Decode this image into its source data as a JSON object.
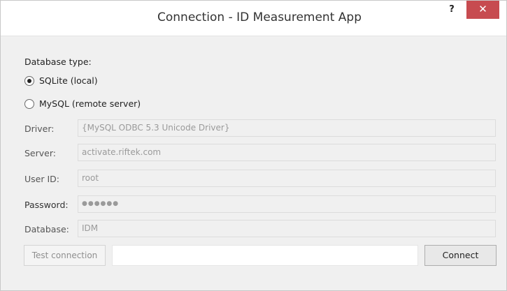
{
  "window": {
    "title": "Connection - ID Measurement App",
    "help_label": "?",
    "close_label": "✕"
  },
  "database_type": {
    "label": "Database type:",
    "options": [
      {
        "label": "SQLite (local)",
        "selected": true
      },
      {
        "label": "MySQL (remote server)",
        "selected": false
      }
    ]
  },
  "fields": {
    "driver": {
      "label": "Driver:",
      "value": "{MySQL ODBC 5.3 Unicode Driver}"
    },
    "server": {
      "label": "Server:",
      "value": "activate.riftek.com"
    },
    "user_id": {
      "label": "User ID:",
      "value": "root"
    },
    "password": {
      "label": "Password:",
      "value": "●●●●●●"
    },
    "database": {
      "label": "Database:",
      "value": "IDM"
    }
  },
  "actions": {
    "test_connection_label": "Test connection",
    "status_text": "",
    "connect_label": "Connect"
  }
}
